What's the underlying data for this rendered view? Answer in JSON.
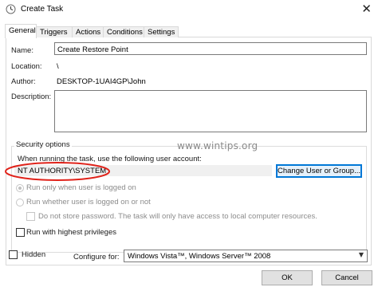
{
  "window": {
    "title": "Create Task",
    "close_glyph": "✕",
    "app_icon": "task-scheduler-icon"
  },
  "tabs": [
    {
      "label": "General",
      "active": true
    },
    {
      "label": "Triggers",
      "active": false
    },
    {
      "label": "Actions",
      "active": false
    },
    {
      "label": "Conditions",
      "active": false
    },
    {
      "label": "Settings",
      "active": false
    }
  ],
  "general": {
    "name_label": "Name:",
    "name_value": "Create Restore Point",
    "location_label": "Location:",
    "location_value": "\\",
    "author_label": "Author:",
    "author_value": "DESKTOP-1UAI4GP\\John",
    "description_label": "Description:",
    "description_value": ""
  },
  "security": {
    "group_title": "Security options",
    "account_prompt": "When running the task, use the following user account:",
    "account_value": "NT AUTHORITY\\SYSTEM",
    "change_button": "Change User or Group...",
    "radio_logged_on": "Run only when user is logged on",
    "radio_logged_on_selected": true,
    "radio_whether": "Run whether user is logged on or not",
    "no_store_password": "Do not store password.  The task will only have access to local computer resources.",
    "highest_privileges": "Run with highest privileges"
  },
  "footer": {
    "hidden_label": "Hidden",
    "configure_label": "Configure for:",
    "configure_value": "Windows Vista™, Windows Server™ 2008",
    "ok_button": "OK",
    "cancel_button": "Cancel"
  },
  "watermark": "www.wintips.org",
  "colors": {
    "highlight_ellipse": "#e0221a",
    "focus_border": "#0078d7"
  }
}
